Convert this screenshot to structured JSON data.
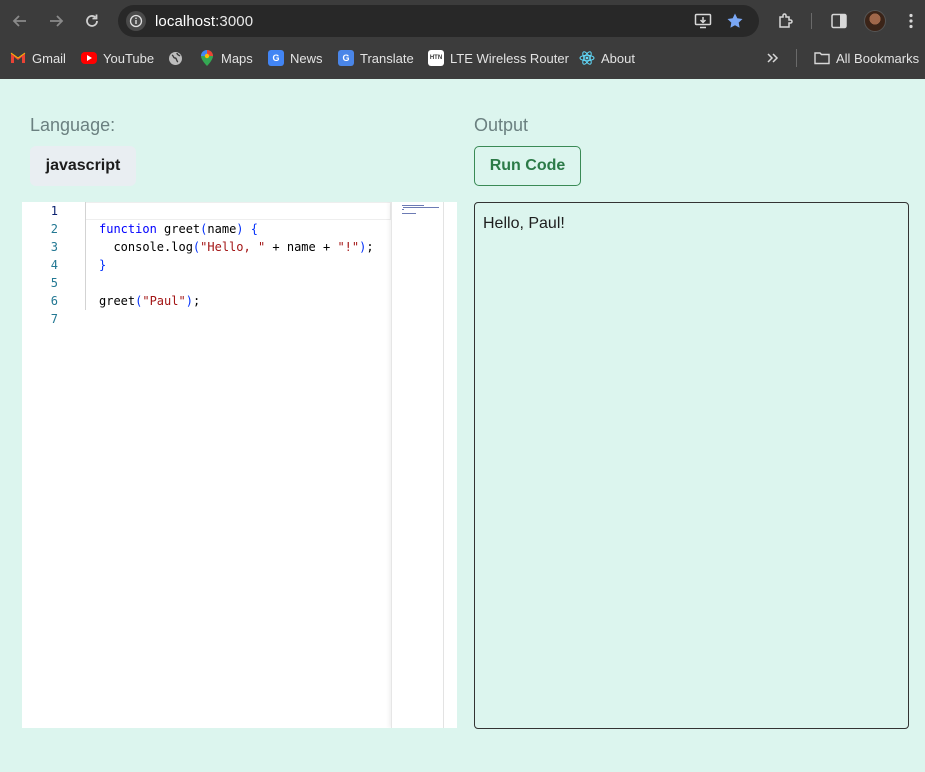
{
  "browser": {
    "url_host": "localhost",
    "url_port": ":3000",
    "bookmarks": [
      {
        "label": "Gmail",
        "icon": "gmail-icon"
      },
      {
        "label": "YouTube",
        "icon": "youtube-icon"
      },
      {
        "label": "",
        "icon": "globe-icon"
      },
      {
        "label": "Maps",
        "icon": "maps-icon"
      },
      {
        "label": "News",
        "icon": "news-icon"
      },
      {
        "label": "Translate",
        "icon": "translate-icon"
      },
      {
        "label": "LTE Wireless Router",
        "icon": "router-icon"
      },
      {
        "label": "About",
        "icon": "react-icon"
      }
    ],
    "all_bookmarks": "All Bookmarks"
  },
  "page": {
    "language_label": "Language:",
    "language_value": "javascript",
    "output_label": "Output",
    "run_button": "Run Code",
    "output_text": "Hello, Paul!"
  },
  "editor": {
    "line_numbers": [
      "1",
      "2",
      "3",
      "4",
      "5",
      "6",
      "7"
    ],
    "lines": [
      "",
      "function greet(name) {",
      "  console.log(\"Hello, \" + name + \"!\");",
      "}",
      "",
      "greet(\"Paul\");",
      ""
    ]
  },
  "colors": {
    "page_background": "#dcf5ee",
    "run_button_accent": "#2b7a47",
    "keyword": "#0000ff",
    "string": "#a31515",
    "line_number": "#237893"
  }
}
